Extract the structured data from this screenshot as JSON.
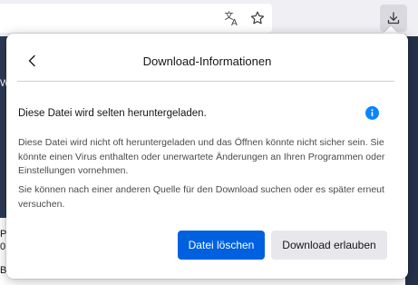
{
  "toolbar": {
    "translate_icon": "translate-icon",
    "bookmark_icon": "star-icon",
    "downloads_icon": "download-arrow-icon"
  },
  "background_page": {
    "fragments": [
      "W",
      "Pr",
      "0",
      "B"
    ]
  },
  "panel": {
    "title": "Download-Informationen",
    "back_icon": "chevron-left-icon",
    "warning_title": "Diese Datei wird selten heruntergeladen.",
    "info_icon": "info-icon",
    "paragraph1": "Diese Datei wird nicht oft heruntergeladen und das Öffnen könnte nicht sicher sein. Sie könnte einen Virus enthalten oder unerwartete Änderungen an Ihren Programmen oder Einstellungen vornehmen.",
    "paragraph2": "Sie können nach einer anderen Quelle für den Download suchen oder es später erneut versuchen.",
    "delete_button": "Datei löschen",
    "allow_button": "Download erlauben"
  },
  "colors": {
    "accent": "#0061e0",
    "info": "#0a84ff"
  }
}
